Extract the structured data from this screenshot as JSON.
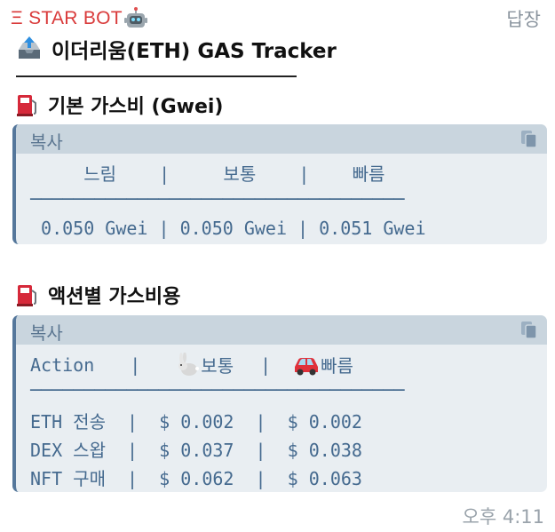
{
  "header": {
    "bot_name": "Ξ STAR BOT",
    "reply_label": "답장"
  },
  "message": {
    "title": "이더리움(ETH) GAS Tracker",
    "sections": [
      {
        "title": "기본 가스비 (Gwei)",
        "copy_label": "복사",
        "lines": [
          "     느림    |     보통    |    빠름",
          "───────────────────────────────────",
          " 0.050 Gwei | 0.050 Gwei | 0.051 Gwei"
        ]
      },
      {
        "title": "액션별 가스비용",
        "copy_label": "복사",
        "header_line": {
          "action": "Action",
          "sep": "|",
          "normal": "보통",
          "fast": "빠름"
        },
        "lines": [
          "───────────────────────────────────",
          "ETH 전송  |  $ 0.002  |  $ 0.002",
          "DEX 스왑  |  $ 0.037  |  $ 0.038",
          "NFT 구매  |  $ 0.062  |  $ 0.063"
        ]
      }
    ],
    "timestamp": "오후 4:11"
  },
  "icons": {
    "title_icon": "outbox-tray-icon",
    "section_icon": "fuel-pump-icon",
    "normal_icon": "rabbit-icon",
    "fast_icon": "car-icon",
    "copy_icon": "copy-icon",
    "robot_icon": "robot-face-icon"
  },
  "colors": {
    "code_bg": "#e9eef2",
    "code_head": "#c9d5de",
    "code_border": "#55779b",
    "code_text": "#456a8f",
    "bot_name": "#d93a3a"
  }
}
